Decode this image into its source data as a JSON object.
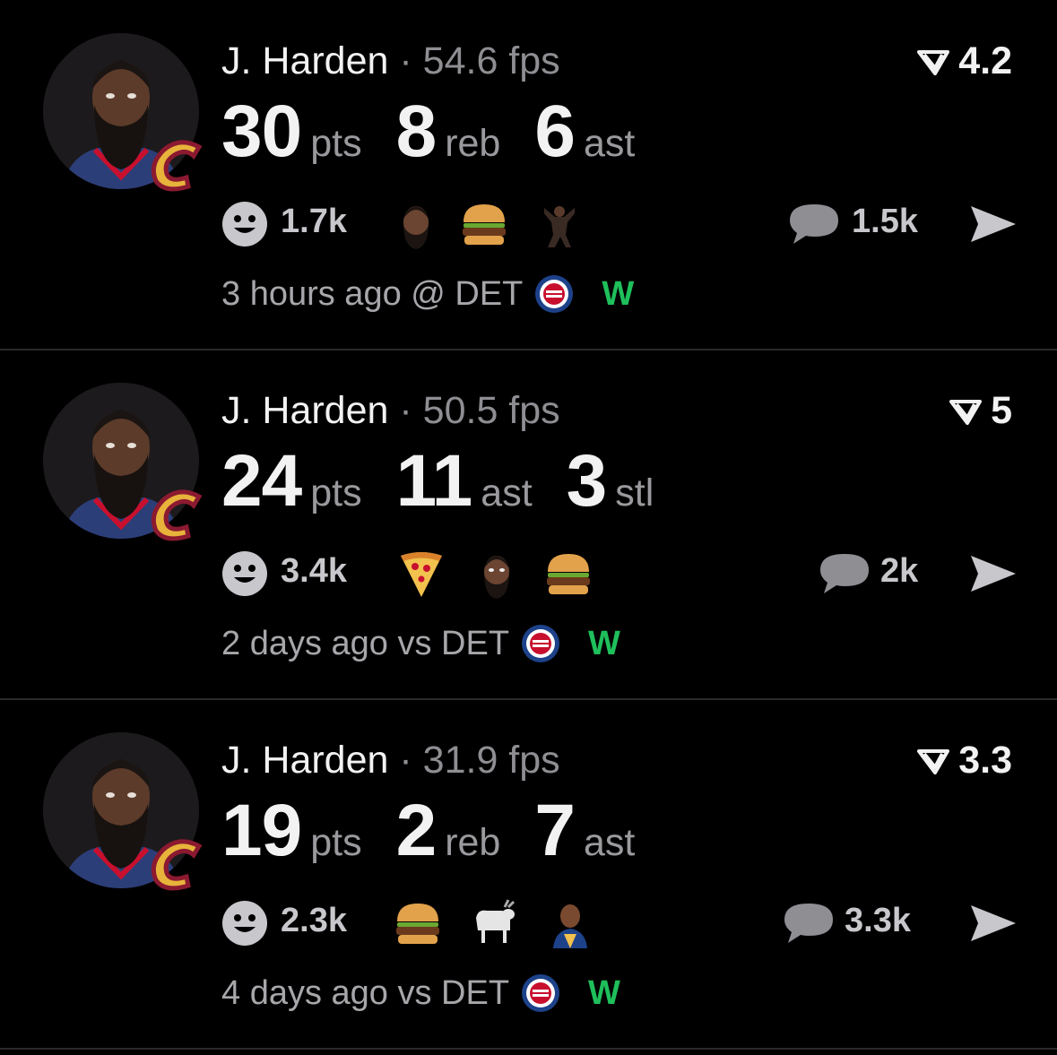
{
  "feed": [
    {
      "player": "J. Harden",
      "separator": "·",
      "fps": "54.6 fps",
      "rating": "4.2",
      "stats": [
        {
          "value": "30",
          "unit": "pts"
        },
        {
          "value": "8",
          "unit": "reb"
        },
        {
          "value": "6",
          "unit": "ast"
        }
      ],
      "reactions": "1.7k",
      "reaction_emojis": [
        "harden-face",
        "burger",
        "player-dunk"
      ],
      "comments": "1.5k",
      "time": "3 hours ago @ DET",
      "opponent_logo": "pistons-logo",
      "result": "W"
    },
    {
      "player": "J. Harden",
      "separator": "·",
      "fps": "50.5 fps",
      "rating": "5",
      "stats": [
        {
          "value": "24",
          "unit": "pts"
        },
        {
          "value": "11",
          "unit": "ast"
        },
        {
          "value": "3",
          "unit": "stl"
        }
      ],
      "reactions": "3.4k",
      "reaction_emojis": [
        "pizza",
        "harden-face",
        "burger"
      ],
      "comments": "2k",
      "time": "2 days ago vs DET",
      "opponent_logo": "pistons-logo",
      "result": "W"
    },
    {
      "player": "J. Harden",
      "separator": "·",
      "fps": "31.9 fps",
      "rating": "3.3",
      "stats": [
        {
          "value": "19",
          "unit": "pts"
        },
        {
          "value": "2",
          "unit": "reb"
        },
        {
          "value": "7",
          "unit": "ast"
        }
      ],
      "reactions": "2.3k",
      "reaction_emojis": [
        "burger",
        "goat",
        "player-portrait"
      ],
      "comments": "3.3k",
      "time": "4 days ago vs DET",
      "opponent_logo": "pistons-logo",
      "result": "W"
    }
  ],
  "colors": {
    "background": "#000000",
    "win": "#1fbf5b",
    "muted": "#8e8e93",
    "team_wine": "#8b1a30",
    "team_gold": "#e8b33b"
  }
}
